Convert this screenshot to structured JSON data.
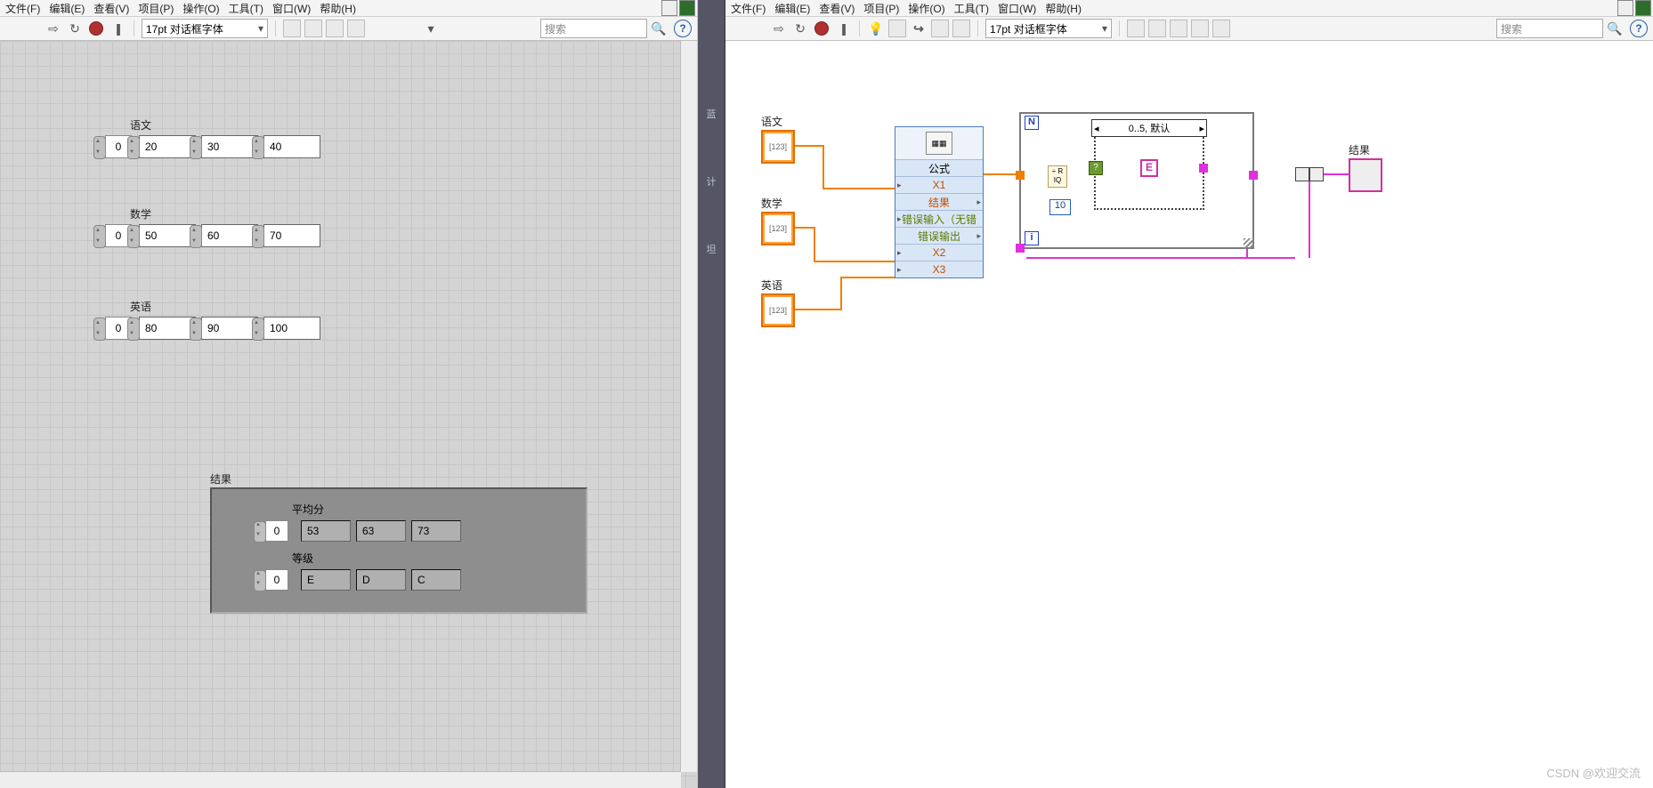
{
  "menus": [
    "文件(F)",
    "编辑(E)",
    "查看(V)",
    "项目(P)",
    "操作(O)",
    "工具(T)",
    "窗口(W)",
    "帮助(H)"
  ],
  "toolbar": {
    "font": "17pt 对话框字体",
    "search_placeholder": "搜索"
  },
  "front_panel": {
    "yuwen": {
      "label": "语文",
      "index": "0",
      "vals": [
        "20",
        "30",
        "40"
      ]
    },
    "shuxue": {
      "label": "数学",
      "index": "0",
      "vals": [
        "50",
        "60",
        "70"
      ]
    },
    "yingyu": {
      "label": "英语",
      "index": "0",
      "vals": [
        "80",
        "90",
        "100"
      ]
    },
    "result": {
      "label": "结果",
      "avg": {
        "label": "平均分",
        "index": "0",
        "vals": [
          "53",
          "63",
          "73"
        ]
      },
      "grade": {
        "label": "等级",
        "index": "0",
        "vals": [
          "E",
          "D",
          "C"
        ]
      }
    }
  },
  "gap_labels": [
    "蓝",
    "计",
    "坦"
  ],
  "block_diagram": {
    "terms": {
      "yuwen": "语文",
      "shuxue": "数学",
      "yingyu": "英语",
      "result": "结果"
    },
    "express": {
      "title": "公式",
      "rows": [
        {
          "t": "X1",
          "type": "lnk",
          "dir": "in"
        },
        {
          "t": "结果",
          "type": "lnk",
          "dir": "out"
        },
        {
          "t": "错误输入（无错",
          "type": "err",
          "dir": "in"
        },
        {
          "t": "错误输出",
          "type": "err",
          "dir": "out"
        },
        {
          "t": "X2",
          "type": "lnk",
          "dir": "in"
        },
        {
          "t": "X3",
          "type": "lnk",
          "dir": "in"
        }
      ]
    },
    "case_selector": "0..5, 默认",
    "qr_fn": "÷ R\nIQ",
    "const10": "10",
    "case_E": "E",
    "N": "N",
    "i": "i"
  },
  "watermark": "CSDN @欢迎交流"
}
